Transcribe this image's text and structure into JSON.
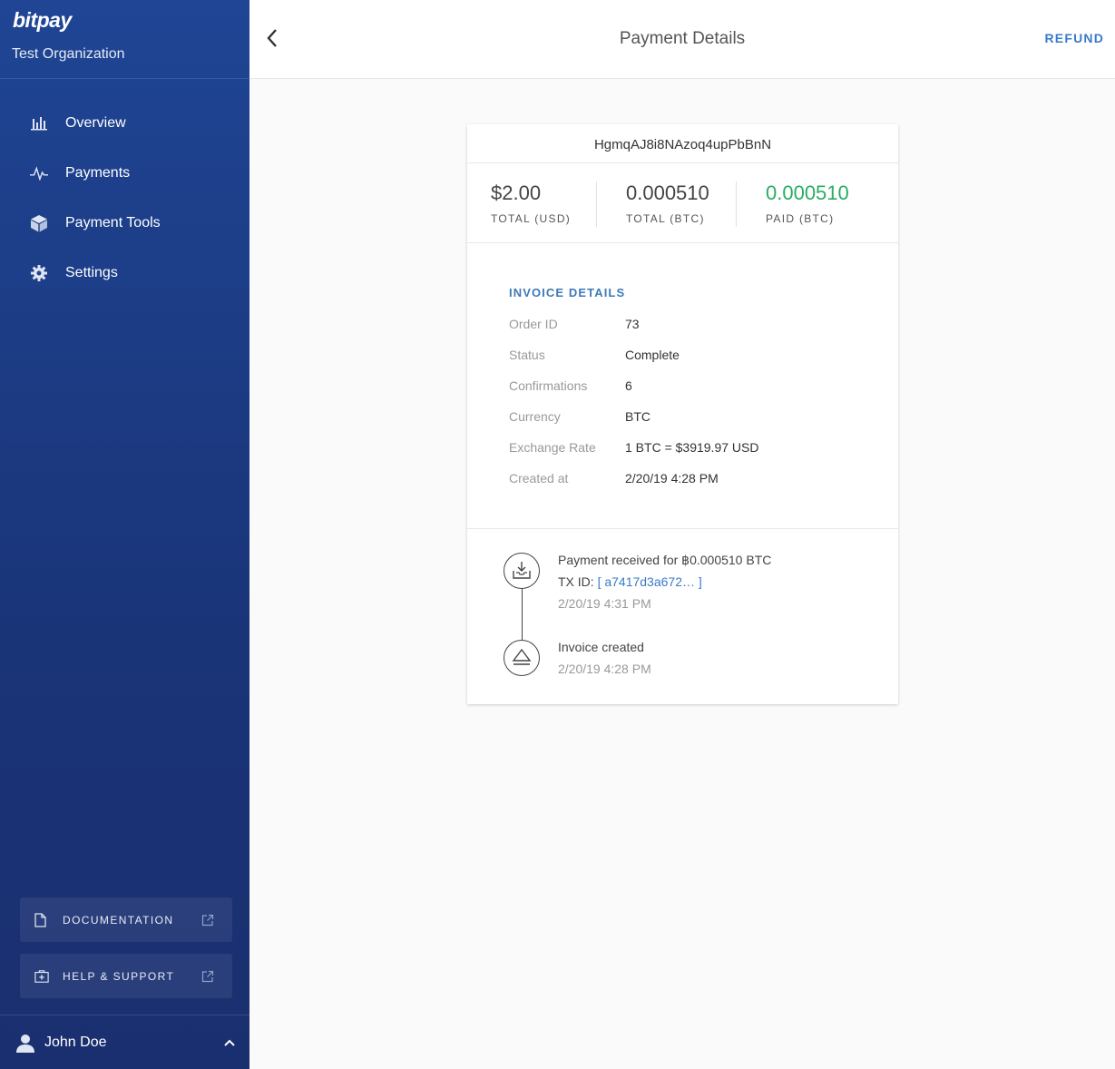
{
  "sidebar": {
    "brand": "bitpay",
    "organization": "Test Organization",
    "nav": [
      {
        "label": "Overview",
        "icon": "bar-chart-icon"
      },
      {
        "label": "Payments",
        "icon": "pulse-icon"
      },
      {
        "label": "Payment Tools",
        "icon": "cube-icon"
      },
      {
        "label": "Settings",
        "icon": "gear-icon"
      }
    ],
    "documentation_label": "DOCUMENTATION",
    "help_label": "HELP & SUPPORT",
    "user_name": "John Doe"
  },
  "header": {
    "title": "Payment Details",
    "refund_label": "REFUND"
  },
  "invoice": {
    "id": "HgmqAJ8i8NAzoq4upPbBnN",
    "totals": [
      {
        "value": "$2.00",
        "label": "TOTAL (USD)"
      },
      {
        "value": "0.000510",
        "label": "TOTAL (BTC)"
      },
      {
        "value": "0.000510",
        "label": "PAID (BTC)"
      }
    ],
    "details_title": "INVOICE DETAILS",
    "details": [
      {
        "key": "Order ID",
        "value": "73"
      },
      {
        "key": "Status",
        "value": "Complete"
      },
      {
        "key": "Confirmations",
        "value": "6"
      },
      {
        "key": "Currency",
        "value": "BTC"
      },
      {
        "key": "Exchange Rate",
        "value": "1 BTC = $3919.97 USD"
      },
      {
        "key": "Created at",
        "value": "2/20/19 4:28 PM"
      }
    ],
    "timeline": [
      {
        "title": "Payment received for ฿0.000510 BTC",
        "tx_label": "TX ID:",
        "tx_open": "[",
        "tx_id": "a7417d3a672…",
        "tx_close": "]",
        "time": "2/20/19 4:31 PM"
      },
      {
        "title": "Invoice created",
        "time": "2/20/19 4:28 PM"
      }
    ]
  },
  "colors": {
    "sidebar": "#1f4594",
    "accent": "#3a7bc8",
    "paid_green": "#27ae60"
  }
}
